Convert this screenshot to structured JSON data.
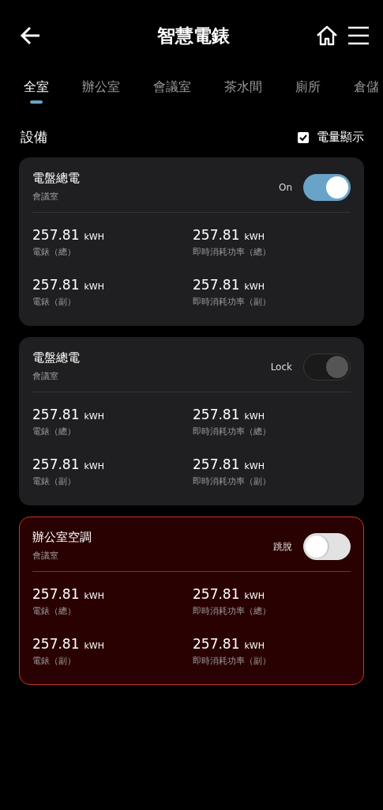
{
  "header": {
    "title": "智慧電錶"
  },
  "tabs": [
    {
      "label": "全室",
      "selected": true
    },
    {
      "label": "辦公室",
      "selected": false
    },
    {
      "label": "會議室",
      "selected": false
    },
    {
      "label": "茶水間",
      "selected": false
    },
    {
      "label": "廁所",
      "selected": false
    },
    {
      "label": "倉儲",
      "selected": false
    }
  ],
  "section": {
    "title": "設備",
    "toggle_label": "電量顯示",
    "checked": true
  },
  "devices": [
    {
      "name": "電盤總電",
      "room": "會議室",
      "status_label": "On",
      "kind": "on",
      "readings": [
        {
          "value": "257.81",
          "unit": "kWH",
          "label": "電錶（總）"
        },
        {
          "value": "257.81",
          "unit": "kWH",
          "label": "即時消耗功率（總）"
        },
        {
          "value": "257.81",
          "unit": "kWH",
          "label": "電錶（副）"
        },
        {
          "value": "257.81",
          "unit": "kWH",
          "label": "即時消耗功率（副）"
        }
      ]
    },
    {
      "name": "電盤總電",
      "room": "會議室",
      "status_label": "Lock",
      "kind": "lock",
      "readings": [
        {
          "value": "257.81",
          "unit": "kWH",
          "label": "電錶（總）"
        },
        {
          "value": "257.81",
          "unit": "kWH",
          "label": "即時消耗功率（總）"
        },
        {
          "value": "257.81",
          "unit": "kWH",
          "label": "電錶（副）"
        },
        {
          "value": "257.81",
          "unit": "kWH",
          "label": "即時消耗功率（副）"
        }
      ]
    },
    {
      "name": "辦公室空調",
      "room": "會議室",
      "status_label": "跳脫",
      "kind": "tripped",
      "readings": [
        {
          "value": "257.81",
          "unit": "kWH",
          "label": "電錶（總）"
        },
        {
          "value": "257.81",
          "unit": "kWH",
          "label": "即時消耗功率（總）"
        },
        {
          "value": "257.81",
          "unit": "kWH",
          "label": "電錶（副）"
        },
        {
          "value": "257.81",
          "unit": "kWH",
          "label": "即時消耗功率（副）"
        }
      ]
    }
  ]
}
